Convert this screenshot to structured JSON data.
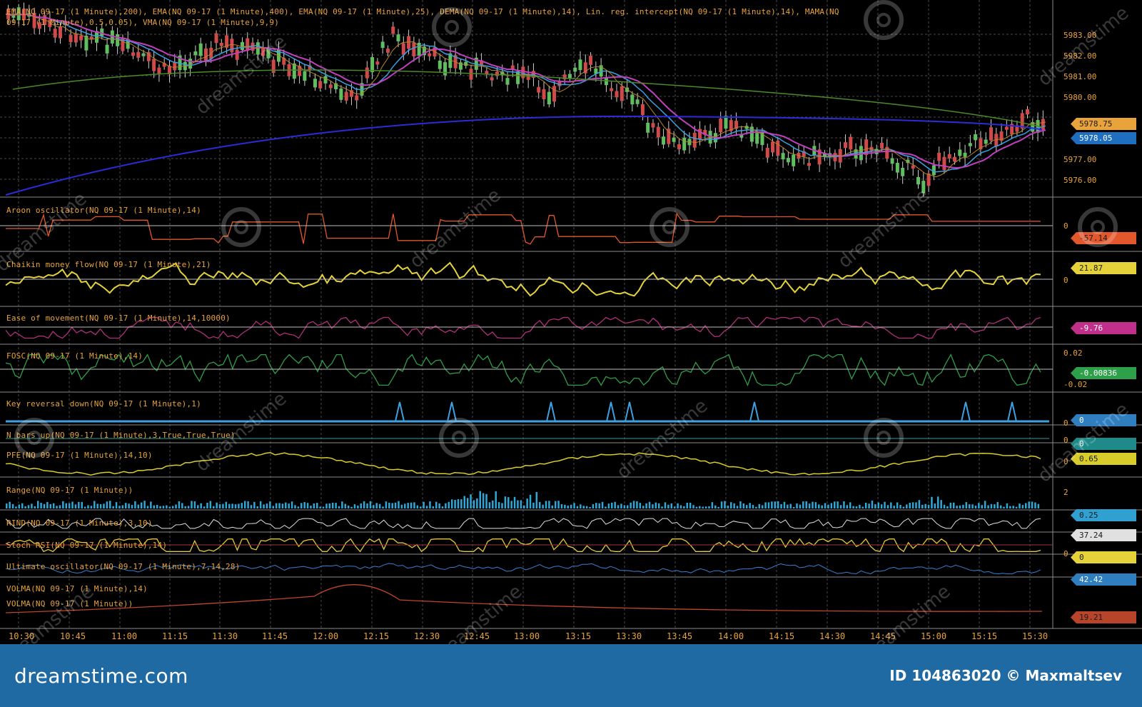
{
  "app": {
    "name": "trading terminal chart"
  },
  "main_pane": {
    "title_line1": "EMA(NQ 09-17 (1 Minute),200), EMA(NQ 09-17 (1 Minute),400), EMA(NQ 09-17 (1 Minute),25), DEMA(NQ 09-17 (1 Minute),14), Lin. reg. intercept(NQ 09-17 (1 Minute),14), MAMA(NQ",
    "title_line2": "09-17 (1 Minute),0.5,0.05), VMA(NQ 09-17 (1 Minute),9,9)",
    "price_labels": [
      "5983.00",
      "5982.00",
      "5981.00",
      "5980.00",
      "5977.00",
      "5976.00"
    ],
    "last_price_tags": [
      {
        "text": "5978.75",
        "bg": "#e8a33a",
        "fg": "#1a1a1a"
      },
      {
        "text": "5978.05",
        "bg": "#1f6fc0",
        "fg": "#ffffff"
      }
    ],
    "colors": {
      "ema200": "#2b2bd9",
      "ema400": "#4a8a2a",
      "ema25": "#c040c0",
      "dema": "#3aa0e0",
      "up_candle": "#5fbf5f",
      "down_candle": "#d04a4a",
      "wick": "#cfcfcf"
    }
  },
  "indicator_panes": [
    {
      "name": "aroon",
      "title": "Aroon oscillator(NQ 09-17 (1 Minute),14)",
      "axis": [
        "0"
      ],
      "tag": "-57.14",
      "tag_bg": "#e2572b",
      "tag_fg": "#1a1a1a",
      "color": "#e2572b"
    },
    {
      "name": "chaikin",
      "title": "Chaikin money flow(NQ 09-17 (1 Minute),21)",
      "axis": [
        "0"
      ],
      "tag": "21.87",
      "tag_bg": "#e5d23a",
      "tag_fg": "#1a1a1a",
      "color": "#e5d23a"
    },
    {
      "name": "eom",
      "title": "Ease of movement(NQ 09-17 (1 Minute),14,10000)",
      "axis": [],
      "tag": "-9.76",
      "tag_bg": "#c0308a",
      "tag_fg": "#ffffff",
      "color": "#b0307a"
    },
    {
      "name": "fosc",
      "title": "FOSC(NQ 09-17 (1 Minute),14)",
      "axis": [
        "0.02",
        "-0.02"
      ],
      "tag": "-0.00836",
      "tag_bg": "#2fa04a",
      "tag_fg": "#ffffff",
      "color": "#2f9e4a"
    },
    {
      "name": "keyrev",
      "title": "Key reversal down(NQ 09-17 (1 Minute),1)",
      "axis": [
        "0"
      ],
      "tag": "0",
      "tag_bg": "#2f7fc0",
      "tag_fg": "#ffffff",
      "color": "#3f9fe0"
    },
    {
      "name": "nbars",
      "title": "N bars up(NQ 09-17 (1 Minute),3,True,True,True)",
      "axis": [
        "0"
      ],
      "tag": "0",
      "tag_bg": "#1f8a8a",
      "tag_fg": "#ffffff",
      "color": "#2aa0a0"
    },
    {
      "name": "pfe",
      "title": "PFE(NQ 09-17 (1 Minute),14,10)",
      "axis": [
        "0"
      ],
      "tag": "0.65",
      "tag_bg": "#d8cc2a",
      "tag_fg": "#1a1a1a",
      "color": "#d8cc2a"
    },
    {
      "name": "range",
      "title": "Range(NQ 09-17 (1 Minute))",
      "axis": [
        "2"
      ],
      "tag": "0.25",
      "tag_bg": "#2fa0d0",
      "tag_fg": "#1a1a1a",
      "color": "#2fa8d8"
    },
    {
      "name": "rind",
      "title": "RIND(NQ 09-17 (1 Minute),3,10)",
      "axis": [],
      "tag": "37.24",
      "tag_bg": "#e0e0e0",
      "tag_fg": "#1a1a1a",
      "color": "#e0e0e0"
    },
    {
      "name": "stochrsi",
      "title": "Stoch RSI(NQ 09-17 (1 Minute),14)",
      "axis": [
        "0"
      ],
      "tag": "0",
      "tag_bg": "#e5d23a",
      "tag_fg": "#1a1a1a",
      "color": "#e5c83a"
    },
    {
      "name": "ultimate",
      "title": "Ultimate oscillator(NQ 09-17 (1 Minute),7,14,28)",
      "axis": [],
      "tag": "42.42",
      "tag_bg": "#2f7fc0",
      "tag_fg": "#ffffff",
      "color": "#3a7fd0"
    },
    {
      "name": "volma",
      "title": "VOLMA(NQ 09-17 (1 Minute),14)",
      "title2": "VOLMA(NQ 09-17 (1 Minute))",
      "axis": [],
      "tag": "19.21",
      "tag_bg": "#b8452a",
      "tag_fg": "#1a1a1a",
      "color": "#c0452a"
    }
  ],
  "time_axis": [
    "10:30",
    "10:45",
    "11:00",
    "11:15",
    "11:30",
    "11:45",
    "12:00",
    "12:15",
    "12:30",
    "12:45",
    "13:00",
    "13:15",
    "13:30",
    "13:45",
    "14:00",
    "14:15",
    "14:30",
    "14:45",
    "15:00",
    "15:15",
    "15:30"
  ],
  "footer": {
    "logo": "dreamstime.com",
    "id_text": "ID 104863020 © Maxmaltsev"
  },
  "watermark": {
    "text": "dreamstime"
  }
}
